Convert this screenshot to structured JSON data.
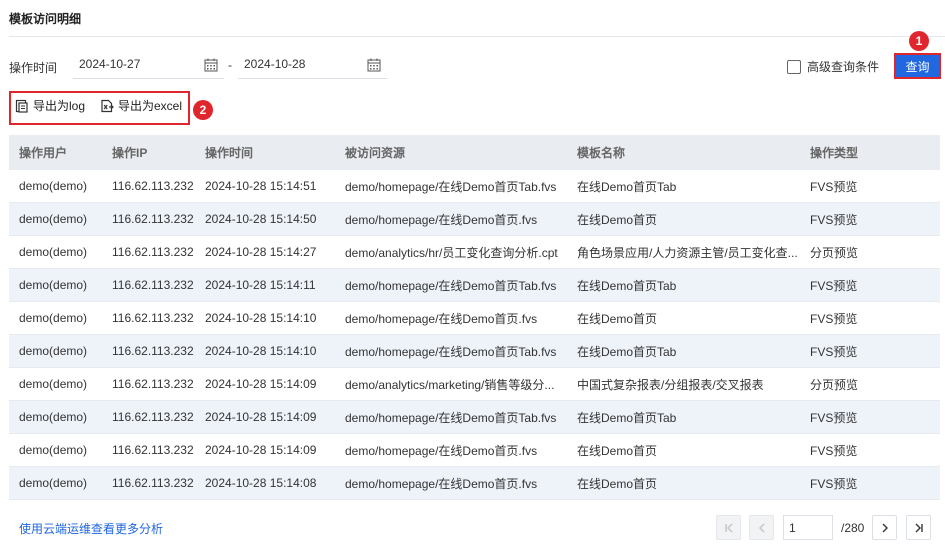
{
  "header": {
    "title": "模板访问明细"
  },
  "filter": {
    "label": "操作时间",
    "start_date": "2024-10-27",
    "separator": "-",
    "end_date": "2024-10-28",
    "advanced_label": "高级查询条件",
    "query_label": "查询"
  },
  "badges": {
    "one": "1",
    "two": "2"
  },
  "export": {
    "log_label": "导出为log",
    "excel_label": "导出为excel"
  },
  "table": {
    "columns": [
      "操作用户",
      "操作IP",
      "操作时间",
      "被访问资源",
      "模板名称",
      "操作类型"
    ],
    "rows": [
      [
        "demo(demo)",
        "116.62.113.232",
        "2024-10-28 15:14:51",
        "demo/homepage/在线Demo首页Tab.fvs",
        "在线Demo首页Tab",
        "FVS预览"
      ],
      [
        "demo(demo)",
        "116.62.113.232",
        "2024-10-28 15:14:50",
        "demo/homepage/在线Demo首页.fvs",
        "在线Demo首页",
        "FVS预览"
      ],
      [
        "demo(demo)",
        "116.62.113.232",
        "2024-10-28 15:14:27",
        "demo/analytics/hr/员工变化查询分析.cpt",
        "角色场景应用/人力资源主管/员工变化查...",
        "分页预览"
      ],
      [
        "demo(demo)",
        "116.62.113.232",
        "2024-10-28 15:14:11",
        "demo/homepage/在线Demo首页Tab.fvs",
        "在线Demo首页Tab",
        "FVS预览"
      ],
      [
        "demo(demo)",
        "116.62.113.232",
        "2024-10-28 15:14:10",
        "demo/homepage/在线Demo首页.fvs",
        "在线Demo首页",
        "FVS预览"
      ],
      [
        "demo(demo)",
        "116.62.113.232",
        "2024-10-28 15:14:10",
        "demo/homepage/在线Demo首页Tab.fvs",
        "在线Demo首页Tab",
        "FVS预览"
      ],
      [
        "demo(demo)",
        "116.62.113.232",
        "2024-10-28 15:14:09",
        "demo/analytics/marketing/销售等级分...",
        "中国式复杂报表/分组报表/交叉报表",
        "分页预览"
      ],
      [
        "demo(demo)",
        "116.62.113.232",
        "2024-10-28 15:14:09",
        "demo/homepage/在线Demo首页Tab.fvs",
        "在线Demo首页Tab",
        "FVS预览"
      ],
      [
        "demo(demo)",
        "116.62.113.232",
        "2024-10-28 15:14:09",
        "demo/homepage/在线Demo首页.fvs",
        "在线Demo首页",
        "FVS预览"
      ],
      [
        "demo(demo)",
        "116.62.113.232",
        "2024-10-28 15:14:08",
        "demo/homepage/在线Demo首页.fvs",
        "在线Demo首页",
        "FVS预览"
      ]
    ]
  },
  "footer": {
    "link": "使用云端运维查看更多分析",
    "current_page": "1",
    "total_pages": "/280"
  },
  "icons": {
    "calendar": "calendar-icon",
    "log": "export-log-icon",
    "excel": "export-excel-icon",
    "first": "first-page-icon",
    "prev": "prev-page-icon",
    "next": "next-page-icon",
    "last": "last-page-icon"
  },
  "colors": {
    "accent": "#2167e0",
    "highlight": "#e0262d",
    "header_bg": "#e9ecf1",
    "alt_row": "#eef3fa"
  }
}
